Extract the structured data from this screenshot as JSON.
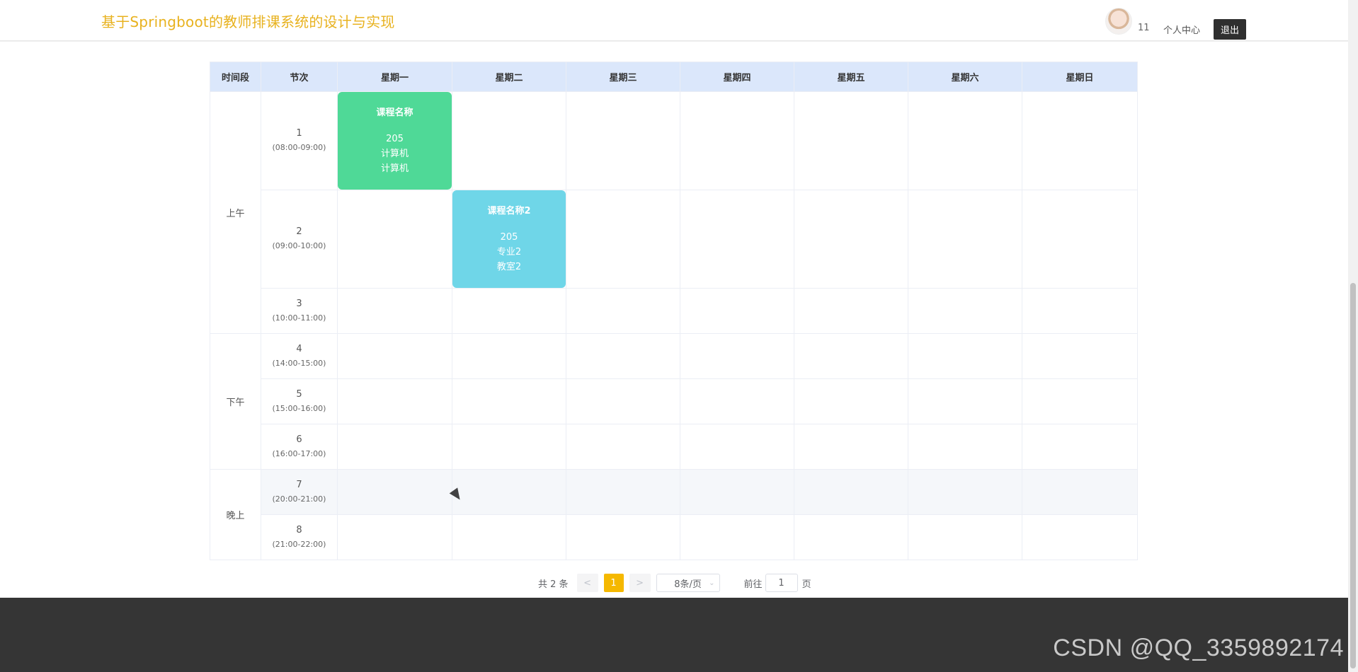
{
  "header": {
    "site_title": "基于Springboot的教师排课系统的设计与实现",
    "username": "11",
    "profile_label": "个人中心",
    "logout_label": "退出"
  },
  "schedule": {
    "columns": [
      "时间段",
      "节次",
      "星期一",
      "星期二",
      "星期三",
      "星期四",
      "星期五",
      "星期六",
      "星期日"
    ],
    "periods": [
      "上午",
      "下午",
      "晚上"
    ],
    "slots": [
      {
        "num": "1",
        "time": "(08:00-09:00)"
      },
      {
        "num": "2",
        "time": "(09:00-10:00)"
      },
      {
        "num": "3",
        "time": "(10:00-11:00)"
      },
      {
        "num": "4",
        "time": "(14:00-15:00)"
      },
      {
        "num": "5",
        "time": "(15:00-16:00)"
      },
      {
        "num": "6",
        "time": "(16:00-17:00)"
      },
      {
        "num": "7",
        "time": "(20:00-21:00)"
      },
      {
        "num": "8",
        "time": "(21:00-22:00)"
      }
    ],
    "courses": [
      {
        "name": "课程名称",
        "room": "205",
        "line2": "计算机",
        "line3": "计算机",
        "color": "#4fd997"
      },
      {
        "name": "课程名称2",
        "room": "205",
        "line2": "专业2",
        "line3": "教室2",
        "color": "#6fd6e8"
      }
    ]
  },
  "pagination": {
    "total": "共 2 条",
    "prev": "<",
    "current": "1",
    "next": ">",
    "page_size": "8条/页",
    "goto_label": "前往",
    "goto_value": "1",
    "page_suffix": "页"
  },
  "footer": {
    "watermark": "CSDN @QQ_3359892174"
  },
  "colors": {
    "accent": "#f5b800",
    "title": "#e8b21f",
    "header_bg": "#dbe7fb",
    "footer_bg": "#353535"
  }
}
